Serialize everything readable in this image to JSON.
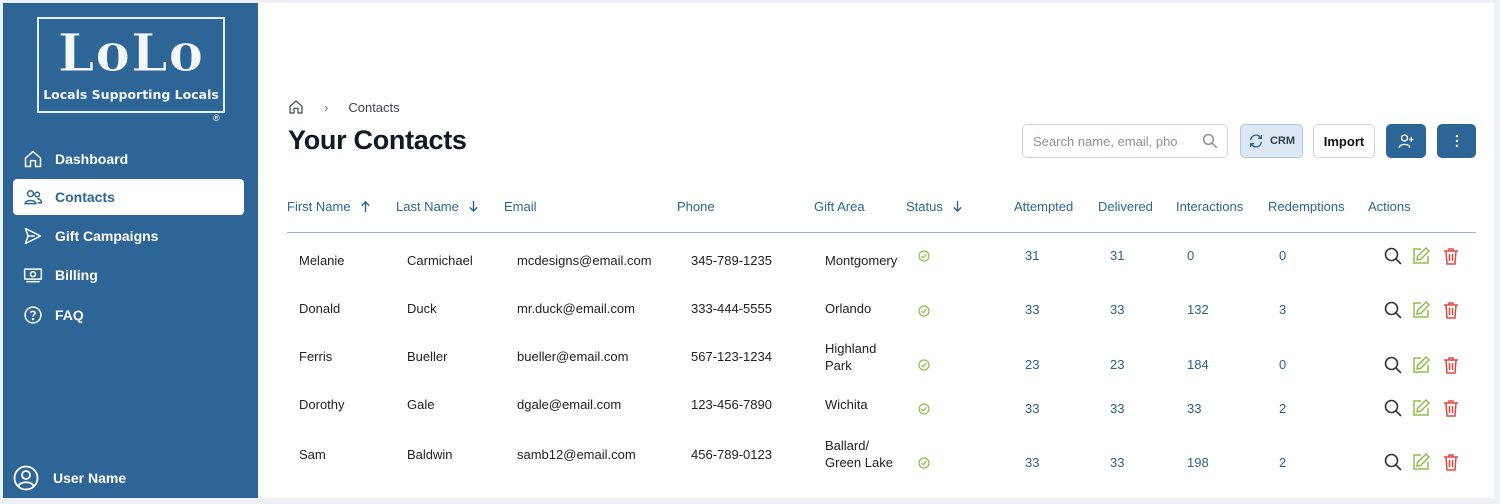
{
  "brand": {
    "logo_main": "LoLo",
    "logo_tagline": "Locals Supporting Locals",
    "logo_mark": "®"
  },
  "sidebar": {
    "items": [
      {
        "label": "Dashboard",
        "icon": "home-icon"
      },
      {
        "label": "Contacts",
        "icon": "users-icon",
        "active": true
      },
      {
        "label": "Gift Campaigns",
        "icon": "send-icon"
      },
      {
        "label": "Billing",
        "icon": "billing-icon"
      },
      {
        "label": "FAQ",
        "icon": "help-circle-icon"
      }
    ],
    "user_name": "User Name"
  },
  "breadcrumb": {
    "current": "Contacts"
  },
  "page_title": "Your Contacts",
  "toolbar": {
    "search_placeholder": "Search name, email, pho",
    "crm_label": "CRM",
    "import_label": "Import"
  },
  "table": {
    "headers": {
      "first_name": "First Name",
      "last_name": "Last Name",
      "email": "Email",
      "phone": "Phone",
      "gift_area": "Gift Area",
      "status": "Status",
      "attempted": "Attempted",
      "delivered": "Delivered",
      "interactions": "Interactions",
      "redemptions": "Redemptions",
      "actions": "Actions"
    },
    "rows": [
      {
        "first": "Melanie",
        "last": "Carmichael",
        "email": "mcdesigns@email.com",
        "phone": "345-789-1235",
        "area1": "Montgomery",
        "area2": "",
        "attempted": "31",
        "delivered": "31",
        "interactions": "0",
        "redemptions": "0"
      },
      {
        "first": "Donald",
        "last": "Duck",
        "email": "mr.duck@email.com",
        "phone": "333-444-5555",
        "area1": "Orlando",
        "area2": "",
        "attempted": "33",
        "delivered": "33",
        "interactions": "132",
        "redemptions": "3"
      },
      {
        "first": "Ferris",
        "last": "Bueller",
        "email": "bueller@email.com",
        "phone": "567-123-1234",
        "area1": "Highland",
        "area2": "Park",
        "attempted": "23",
        "delivered": "23",
        "interactions": "184",
        "redemptions": "0"
      },
      {
        "first": "Dorothy",
        "last": "Gale",
        "email": "dgale@email.com",
        "phone": "123-456-7890",
        "area1": "Wichita",
        "area2": "",
        "attempted": "33",
        "delivered": "33",
        "interactions": "33",
        "redemptions": "2"
      },
      {
        "first": "Sam",
        "last": "Baldwin",
        "email": "samb12@email.com",
        "phone": "456-789-0123",
        "area1": "Ballard/",
        "area2": "Green Lake",
        "attempted": "33",
        "delivered": "33",
        "interactions": "198",
        "redemptions": "2"
      }
    ]
  },
  "colors": {
    "brand_blue": "#2d6596",
    "status_green": "#8dbf4a",
    "edit_green": "#8dbf4a",
    "delete_red": "#e5483f"
  }
}
